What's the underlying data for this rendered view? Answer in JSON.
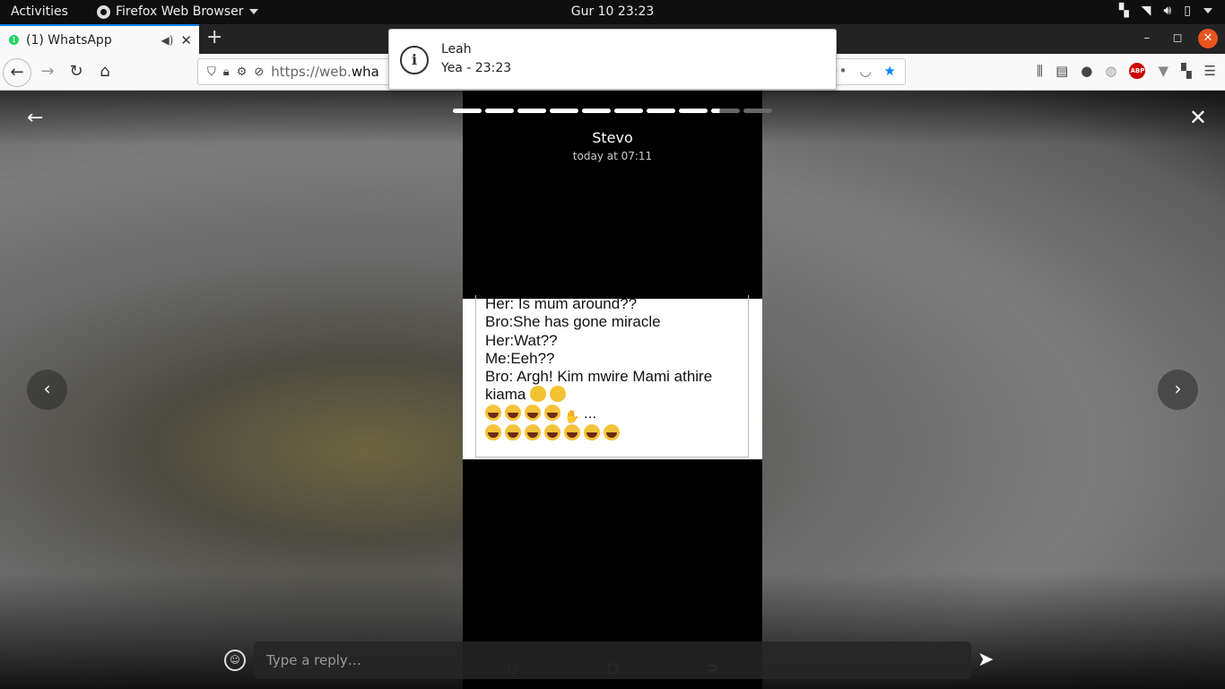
{
  "topbar": {
    "activities": "Activities",
    "app_name": "Firefox Web Browser",
    "clock": "Gur 10  23:23"
  },
  "browser": {
    "tab": {
      "badge": "1",
      "title": "(1) WhatsApp"
    },
    "url_prefix": "https://web.",
    "url_host": "wha"
  },
  "notification": {
    "sender": "Leah",
    "message": "Yea - 23:23"
  },
  "status_viewer": {
    "author": "Stevo",
    "timestamp": "today at 07:11",
    "progress": {
      "segments": 10,
      "completed": 8,
      "current_fraction": 0.3
    },
    "content_lines": [
      "Her: Is mum around??",
      "Bro:She has gone miracle",
      "Her:Wat??",
      "Me:Eeh??",
      "Bro: Argh! Kim mwire Mami athire",
      "kiama"
    ],
    "content_trailing": "...",
    "reply_placeholder": "Type a reply…"
  },
  "icons": {
    "tray": [
      "apps-icon",
      "wifi-icon",
      "volume-icon",
      "battery-icon",
      "power-menu-icon"
    ],
    "toolbar": [
      "library-icon",
      "sidebar-icon",
      "account-icon",
      "globe-icon",
      "adblock-plus-icon",
      "vpn-icon",
      "extensions-icon",
      "menu-icon"
    ],
    "adblock_label": "ABP"
  },
  "colors": {
    "accent": "#0a84ff",
    "whatsapp_green": "#25d366",
    "close_button": "#e95420"
  }
}
